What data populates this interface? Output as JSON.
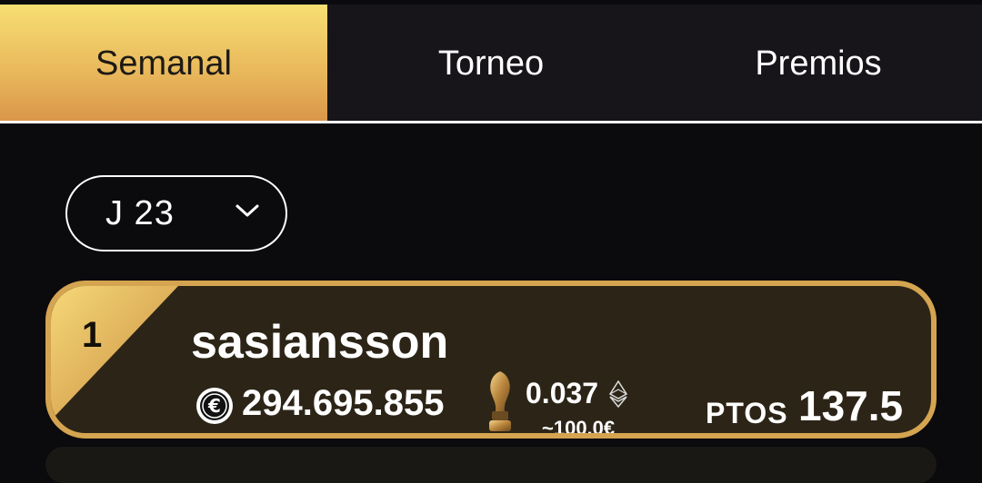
{
  "tabs": [
    {
      "label": "Semanal",
      "active": true
    },
    {
      "label": "Torneo",
      "active": false
    },
    {
      "label": "Premios",
      "active": false
    }
  ],
  "round_select": {
    "value": "J 23",
    "icon": "chevron-down-icon"
  },
  "ranking": [
    {
      "position": "1",
      "username": "sasiansson",
      "coins": "294.695.855",
      "eth_amount": "0.037",
      "eur_equivalent": "~100.0€",
      "points_label": "PTOS",
      "points": "137.5"
    }
  ],
  "colors": {
    "accent_gold": "#d5a450",
    "background": "#0b0a0c",
    "tab_bar": "#17151a"
  }
}
